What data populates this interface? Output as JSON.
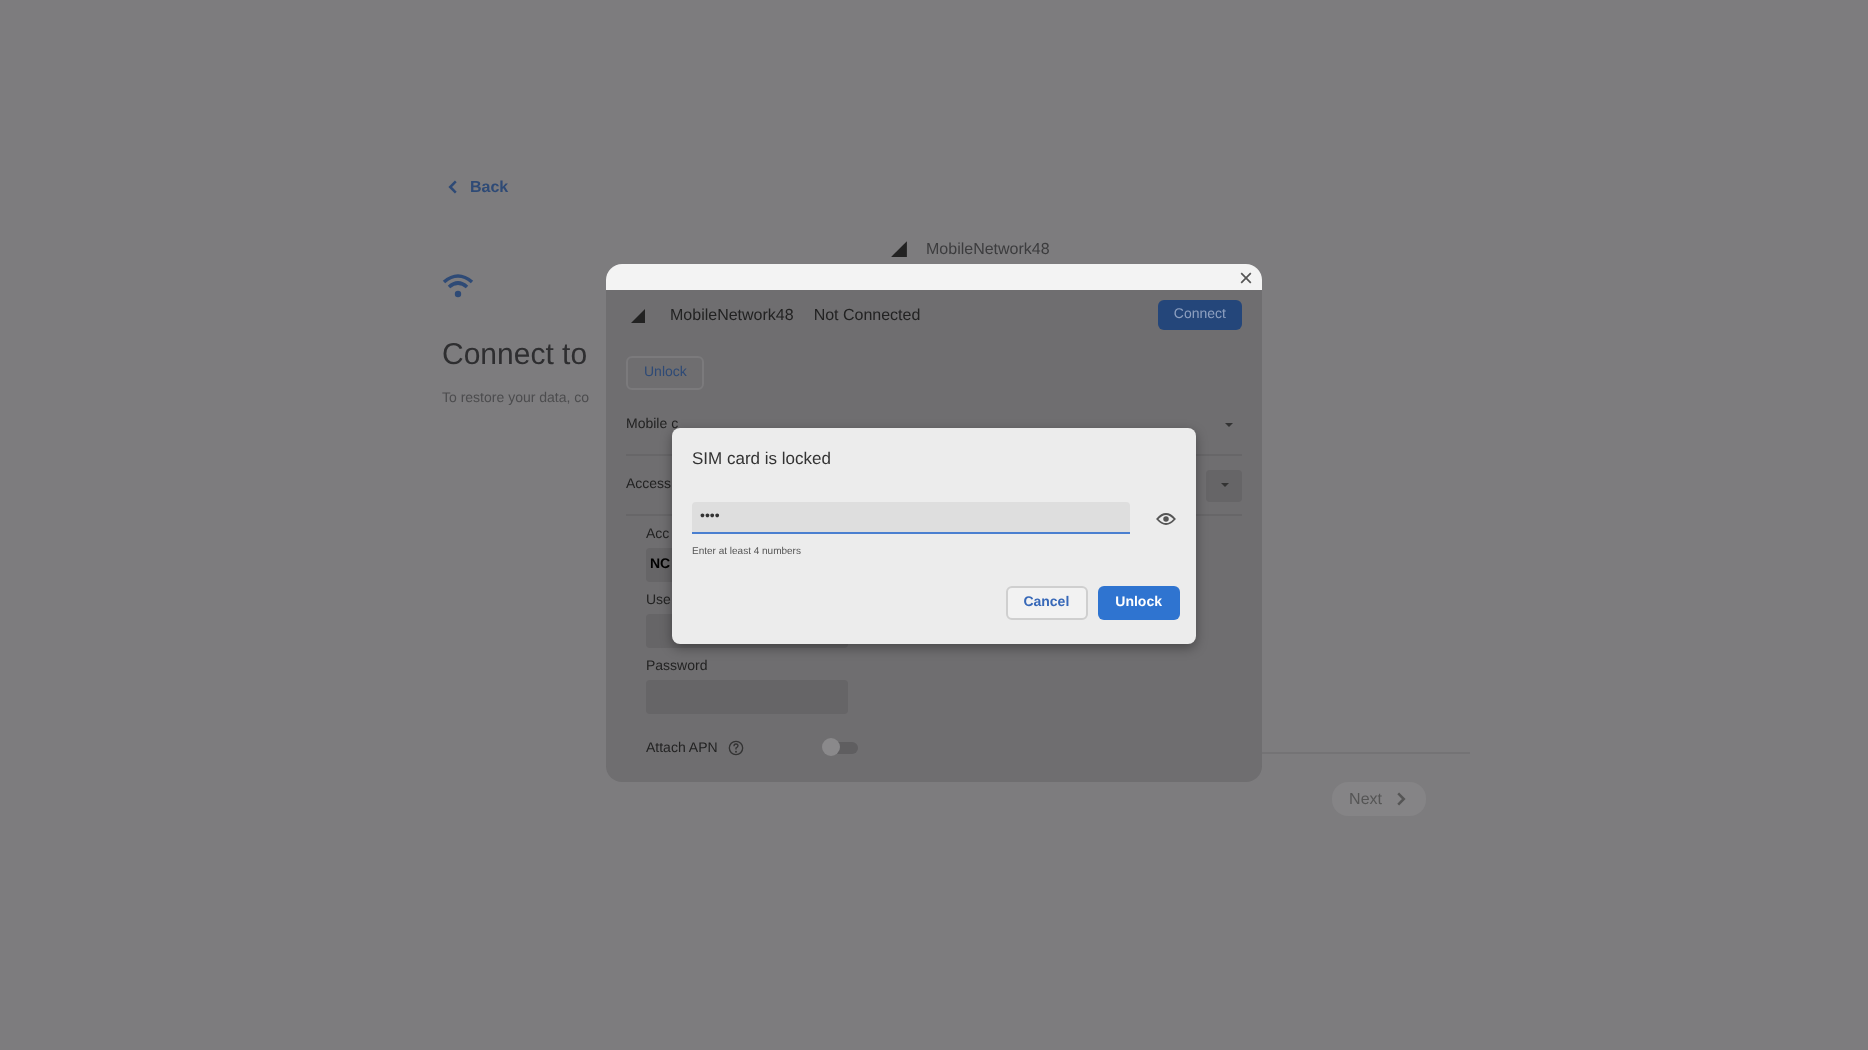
{
  "page": {
    "back": "Back",
    "title": "Connect to",
    "subtitle": "To restore your data, co",
    "network_name": "MobileNetwork48",
    "next": "Next"
  },
  "network_dialog": {
    "network_name": "MobileNetwork48",
    "status": "Not Connected",
    "connect": "Connect",
    "unlock": "Unlock",
    "mobile_label": "Mobile c",
    "access_label": "Access",
    "fields": [
      {
        "label": "Acc",
        "value": "NC"
      },
      {
        "label": "Use"
      },
      {
        "label": "Password"
      }
    ],
    "attach_apn": {
      "label": "Attach APN",
      "on": false
    }
  },
  "sim_dialog": {
    "title": "SIM card is locked",
    "pin": "••••",
    "hint": "Enter at least 4 numbers",
    "cancel": "Cancel",
    "unlock": "Unlock"
  }
}
